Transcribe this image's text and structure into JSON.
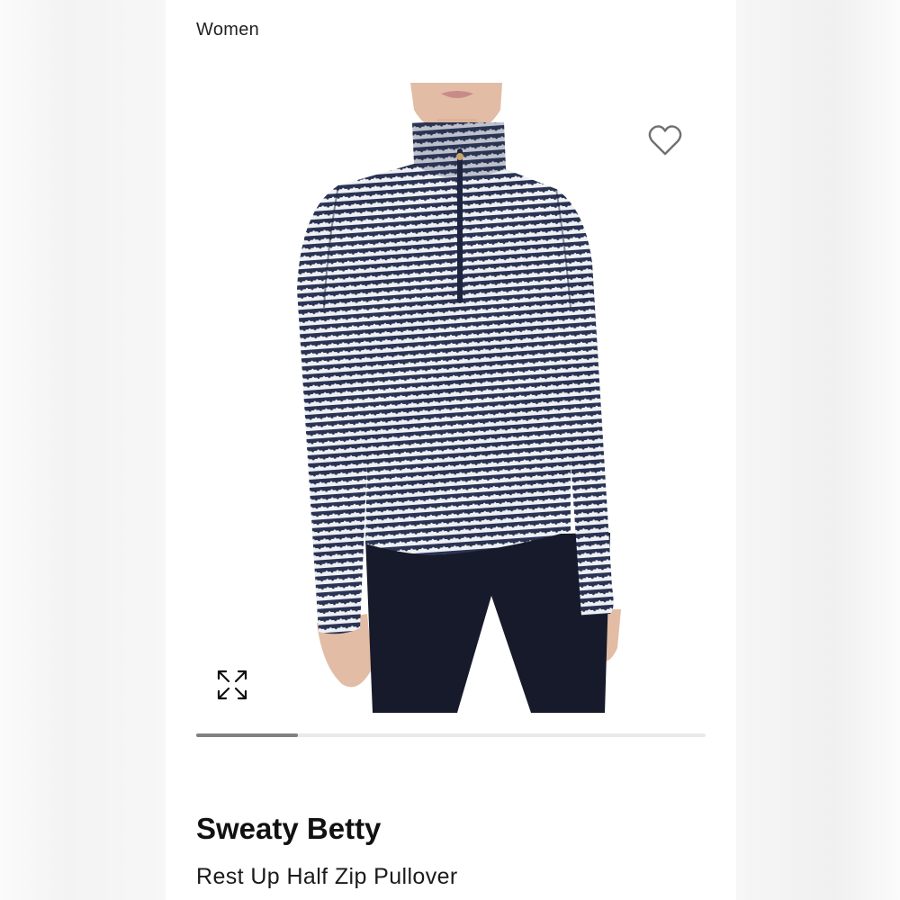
{
  "breadcrumb": "Women",
  "product": {
    "brand": "Sweaty Betty",
    "name": "Rest Up Half Zip Pullover",
    "image": "model wearing navy and white striped half-zip pullover with navy leggings"
  },
  "icons": {
    "favorite": "heart-outline-icon",
    "fullscreen": "expand-arrows-icon"
  },
  "gallery": {
    "progress": 0.2
  },
  "colors": {
    "sweater_navy": "#2a3352",
    "sweater_white": "#eef0f4",
    "leggings": "#161a2a",
    "skin": "#e2bca4",
    "progress_fill": "#808080",
    "progress_track": "#e9e9e9"
  }
}
